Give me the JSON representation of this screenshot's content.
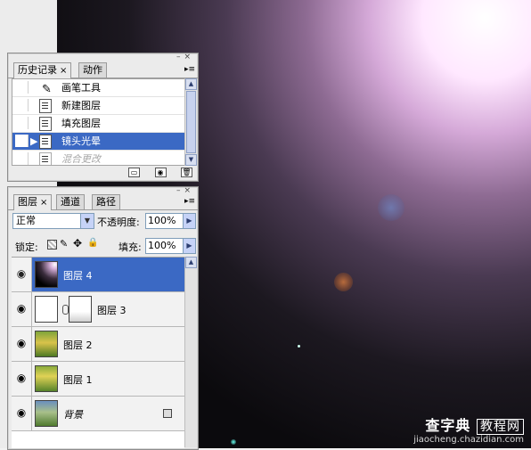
{
  "history_panel": {
    "tabs": [
      {
        "label": "历史记录",
        "close": "×"
      },
      {
        "label": "动作"
      }
    ],
    "items": [
      {
        "label": "画笔工具",
        "state": "normal"
      },
      {
        "label": "新建图层",
        "state": "normal"
      },
      {
        "label": "填充图层",
        "state": "normal"
      },
      {
        "label": "镜头光晕",
        "state": "selected"
      },
      {
        "label": "混合更改",
        "state": "disabled"
      }
    ]
  },
  "layers_panel": {
    "tabs": [
      {
        "label": "图层",
        "close": "×"
      },
      {
        "label": "通道"
      },
      {
        "label": "路径"
      }
    ],
    "blend_mode": "正常",
    "opacity_label": "不透明度:",
    "opacity_value": "100%",
    "lock_label": "锁定:",
    "fill_label": "填充:",
    "fill_value": "100%",
    "layers": [
      {
        "name": "图层 4",
        "selected": true
      },
      {
        "name": "图层 3",
        "selected": false,
        "has_mask": true
      },
      {
        "name": "图层 2",
        "selected": false
      },
      {
        "name": "图层 1",
        "selected": false
      },
      {
        "name": "背景",
        "selected": false,
        "locked": true
      }
    ]
  },
  "watermark": {
    "brand": "查字典",
    "brand_box": "教程网",
    "url": "jiaocheng.chazidian.com"
  },
  "colors": {
    "selection": "#3b69c4",
    "panel_bg": "#ebebeb"
  }
}
